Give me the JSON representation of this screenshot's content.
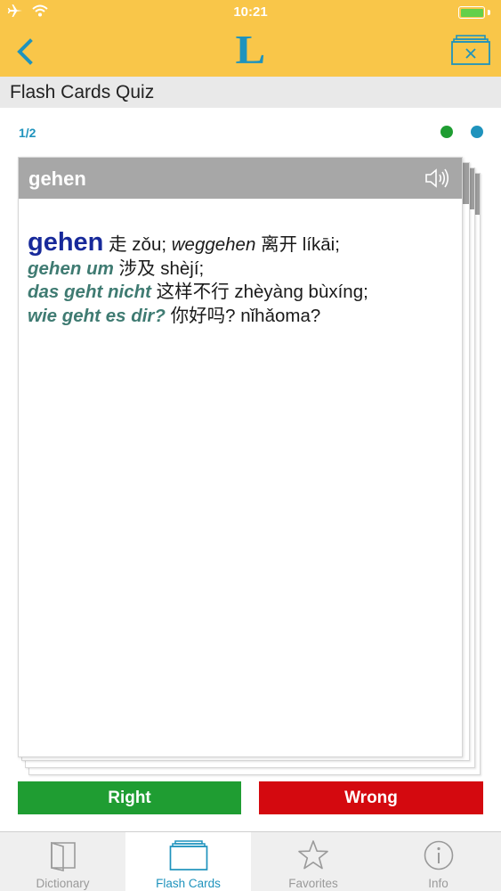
{
  "status_bar": {
    "time": "10:21",
    "icons": [
      "airplane-icon",
      "wifi-icon",
      "battery-icon"
    ]
  },
  "nav": {
    "logo": "L",
    "back_icon": "chevron-left-icon",
    "close_icon": "close-deck-icon"
  },
  "title": "Flash Cards Quiz",
  "quiz": {
    "counter": "1/2",
    "indicator_colors": [
      "#1f9d32",
      "#1f93bd"
    ]
  },
  "card": {
    "word": "gehen",
    "audio_icon": "speaker-icon",
    "entry": {
      "headword": "gehen",
      "line1_zh": " 走 zǒu; ",
      "line1_de": "weggehen",
      "line1_zh2": " 离开 líkāi;",
      "phrases": [
        {
          "de": "gehen um",
          "zh": " 涉及 shèjí;"
        },
        {
          "de": "das geht nicht",
          "zh": " 这样不行 zhèyàng bùxíng;"
        },
        {
          "de": "wie geht es dir?",
          "zh": " 你好吗? nǐhǎoma?"
        }
      ]
    }
  },
  "buttons": {
    "right": "Right",
    "wrong": "Wrong"
  },
  "tabs": [
    {
      "label": "Dictionary",
      "icon": "dictionary-icon",
      "active": false
    },
    {
      "label": "Flash Cards",
      "icon": "flash-cards-icon",
      "active": true
    },
    {
      "label": "Favorites",
      "icon": "star-icon",
      "active": false
    },
    {
      "label": "Info",
      "icon": "info-icon",
      "active": false
    }
  ],
  "colors": {
    "header": "#f9c649",
    "accent": "#1f93bd",
    "right_button": "#1f9d32",
    "wrong_button": "#d4090f",
    "headword": "#17299a",
    "phrase": "#3f7b72"
  }
}
